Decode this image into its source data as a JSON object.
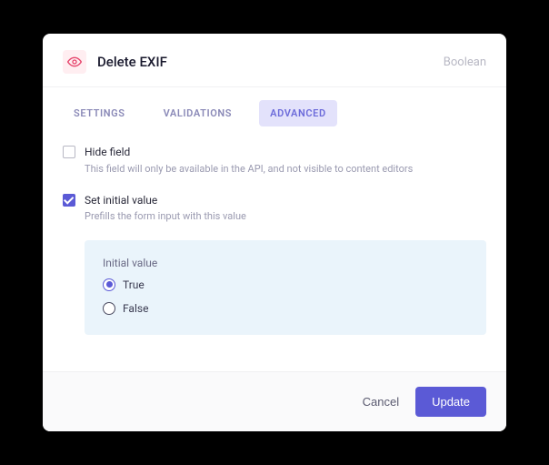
{
  "header": {
    "title": "Delete EXIF",
    "type_label": "Boolean"
  },
  "tabs": {
    "items": [
      {
        "label": "SETTINGS"
      },
      {
        "label": "VALIDATIONS"
      },
      {
        "label": "ADVANCED"
      }
    ],
    "active_index": 2
  },
  "options": {
    "hide_field": {
      "label": "Hide field",
      "description": "This field will only be available in the API, and not visible to content editors",
      "checked": false
    },
    "set_initial": {
      "label": "Set initial value",
      "description": "Prefills the form input with this value",
      "checked": true
    }
  },
  "initial_value": {
    "section_label": "Initial value",
    "true_label": "True",
    "false_label": "False",
    "selected": "true"
  },
  "footer": {
    "cancel_label": "Cancel",
    "update_label": "Update"
  }
}
